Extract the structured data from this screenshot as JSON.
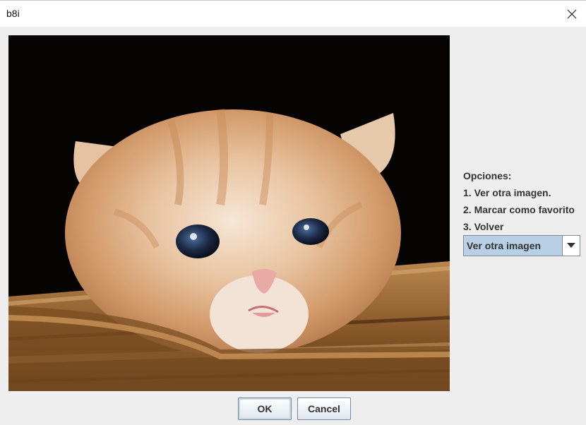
{
  "window": {
    "title": "b8i"
  },
  "options": {
    "heading": "Opciones:",
    "items": [
      "1. Ver otra imagen.",
      "2. Marcar como favorito",
      "3. Volver"
    ]
  },
  "combo": {
    "selected": "Ver otra imagen"
  },
  "buttons": {
    "ok": "OK",
    "cancel": "Cancel"
  },
  "colors": {
    "background": "#eeeeee",
    "combo_selection": "#b8cfe5",
    "border": "#7a8a99"
  },
  "icons": {
    "close": "close-icon",
    "dropdown": "chevron-down-icon"
  }
}
